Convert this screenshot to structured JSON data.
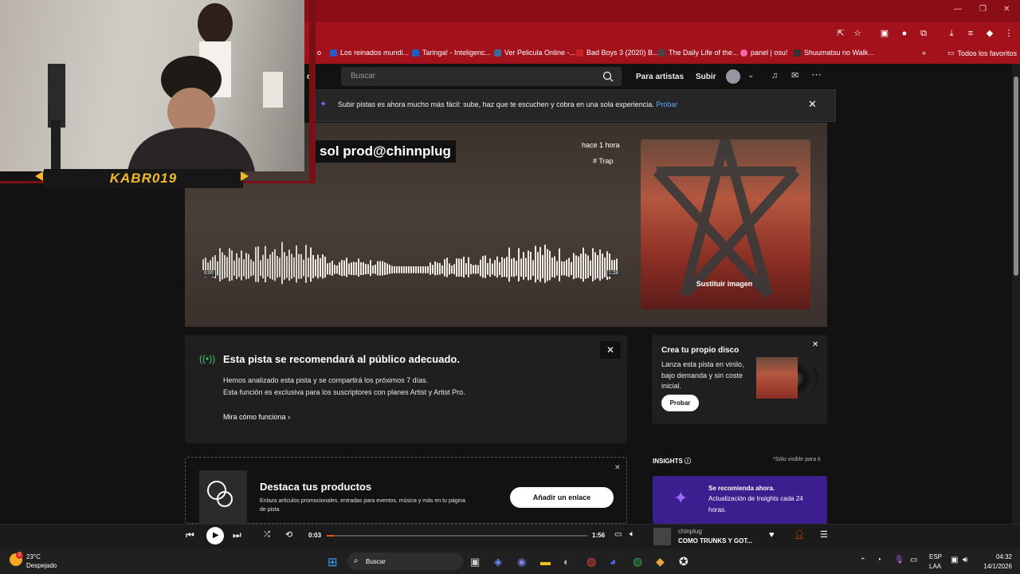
{
  "browser": {
    "bookmarks": [
      {
        "label": "Los reinados mundi...",
        "color": "#2b58c7"
      },
      {
        "label": "Taringa! - Inteligenc...",
        "color": "#1b5fcf"
      },
      {
        "label": "Ver Pelicula Online -...",
        "color": "#3a6a9a"
      },
      {
        "label": "Bad Boys 3 (2020) B...",
        "color": "#cc2222"
      },
      {
        "label": "The Daily Life of the...",
        "color": "#444444"
      },
      {
        "label": "panel | osu!",
        "color": "#ff66aa"
      },
      {
        "label": "Shuumatsu no Walk...",
        "color": "#333333"
      }
    ],
    "bookmarks_folder": "Todos los favoritos",
    "bookmark_partial": "o"
  },
  "header": {
    "nav_partial": "ca",
    "search_placeholder": "Buscar",
    "for_artists": "Para artistas",
    "upload": "Subir"
  },
  "banner": {
    "text": "Subir pistas es ahora mucho más fácil: sube, haz que te escuchen y cobra en una sola experiencia.",
    "link": "Probar"
  },
  "track": {
    "title": "sol prod@chinnplug",
    "time_ago": "hace 1 hora",
    "tag": "# Trap",
    "cover_action": "Sustituir imagen",
    "wave_start": "0:00",
    "wave_end": "1:28"
  },
  "recommend": {
    "title": "Esta pista se recomendará al público adecuado.",
    "line1": "Hemos analizado esta pista y se compartirá los próximos 7 días.",
    "line2": "Esta función es exclusiva para los suscriptores con planes Artist y Artist Pro.",
    "link": "Mira cómo funciona"
  },
  "vinyl": {
    "title": "Crea tu propio disco",
    "line1": "Lanza esta pista en vinilo,",
    "line2": "bajo demanda y sin coste",
    "line3": "inicial.",
    "button": "Probar"
  },
  "highlight": {
    "title": "Destaca tus productos",
    "line1": "Enlaza artículos promocionales, entradas para eventos, música y más en tu página",
    "line2": "de pista",
    "button": "Añadir un enlace"
  },
  "insights": {
    "title": "INSIGHTS",
    "note": "*Sólo visible para ti",
    "line1": "Se recomienda ahora.",
    "line2": "Actualización de Insights cada 24",
    "line3": "horas."
  },
  "player": {
    "current": "0:03",
    "total": "1:56",
    "progress": 0.026,
    "artist": "chinplug",
    "title": "COMO TRUNKS Y GOT..."
  },
  "webcam": {
    "label": "KABR019"
  },
  "taskbar": {
    "weather_temp": "23°C",
    "weather_text": "Despejado",
    "weather_badge": "2",
    "search": "Buscar",
    "lang1": "ESP",
    "lang2": "LAA",
    "time": "04:32",
    "date": "14/1/2026"
  }
}
